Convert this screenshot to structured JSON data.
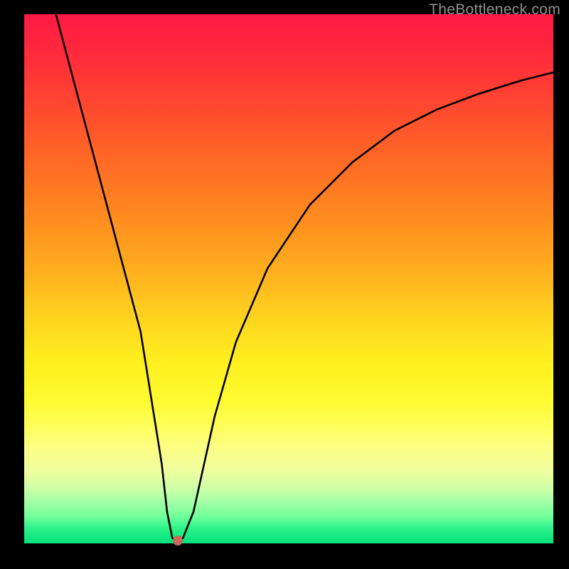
{
  "watermark": "TheBottleneck.com",
  "chart_data": {
    "type": "line",
    "title": "",
    "xlabel": "",
    "ylabel": "",
    "xlim": [
      0,
      100
    ],
    "ylim": [
      0,
      100
    ],
    "series": [
      {
        "name": "curve",
        "x": [
          6,
          10,
          14,
          18,
          22,
          26,
          27,
          28,
          29,
          30,
          32,
          34,
          36,
          40,
          46,
          54,
          62,
          70,
          78,
          86,
          94,
          100
        ],
        "y": [
          100,
          85,
          70,
          55,
          40,
          15,
          6,
          1,
          0.5,
          1,
          6,
          15,
          24,
          38,
          52,
          64,
          72,
          78,
          82,
          85,
          87.5,
          89
        ]
      }
    ],
    "marker": {
      "x": 29,
      "y": 0.5,
      "color": "#c86a5a"
    }
  },
  "colors": {
    "frame": "#000000",
    "watermark": "#8f8f8f",
    "gradient_top": "#ff1944",
    "gradient_bottom": "#00e07b",
    "curve": "#000000",
    "marker": "#c86a5a"
  }
}
